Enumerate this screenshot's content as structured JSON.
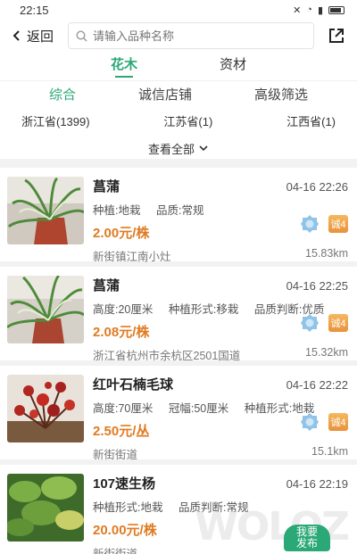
{
  "status_bar": {
    "time": "22:15"
  },
  "header": {
    "back_label": "返回",
    "search_placeholder": "请输入品种名称"
  },
  "category_tabs": [
    {
      "label": "花木",
      "active": true
    },
    {
      "label": "资材",
      "active": false
    }
  ],
  "sort_tabs": [
    {
      "label": "综合",
      "active": true
    },
    {
      "label": "诚信店铺",
      "active": false
    },
    {
      "label": "高级筛选",
      "active": false
    }
  ],
  "provinces": [
    "浙江省(1399)",
    "江苏省(1)",
    "江西省(1)"
  ],
  "view_all_label": "查看全部",
  "colors": {
    "accent": "#2aa876",
    "price": "#e07b21",
    "trust_badge": "#e9923a"
  },
  "items": [
    {
      "title": "菖蒲",
      "time": "04-16 22:26",
      "attrs": [
        "种植:地栽",
        "品质:常规"
      ],
      "price": "2.00元/株",
      "location": "新街镇江南小灶",
      "distance": "15.83km",
      "trust_badge": "诚4",
      "image": "spider-plant-pot"
    },
    {
      "title": "菖蒲",
      "time": "04-16 22:25",
      "attrs": [
        "高度:20厘米",
        "种植形式:移栽",
        "品质判断:优质"
      ],
      "price": "2.08元/株",
      "location": "浙江省杭州市余杭区2501国道",
      "distance": "15.32km",
      "trust_badge": "诚4",
      "image": "spider-plant-pot"
    },
    {
      "title": "红叶石楠毛球",
      "time": "04-16 22:22",
      "attrs": [
        "高度:70厘米",
        "冠幅:50厘米",
        "种植形式:地栽"
      ],
      "price": "2.50元/丛",
      "location": "新街街道",
      "distance": "15.1km",
      "trust_badge": "诚4",
      "image": "red-shrub"
    },
    {
      "title": "107速生杨",
      "time": "04-16 22:19",
      "attrs": [
        "种植形式:地栽",
        "品质判断:常规"
      ],
      "price": "20.00元/株",
      "location": "新街街道",
      "distance": "",
      "trust_badge": "",
      "image": "green-leaves"
    }
  ],
  "publish_button": {
    "line1": "我要",
    "line2": "发布"
  },
  "watermark": "WOLOZ"
}
